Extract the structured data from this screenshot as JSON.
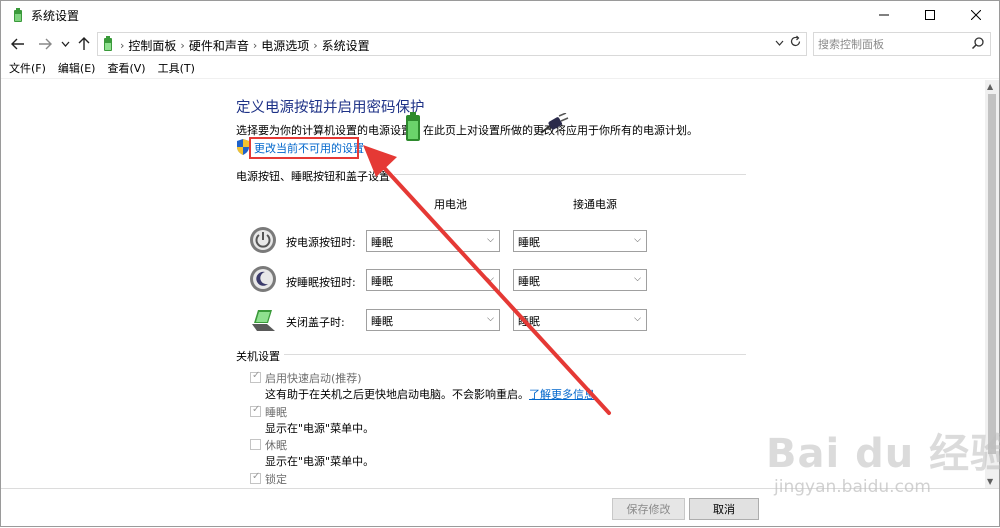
{
  "window": {
    "title": "系统设置"
  },
  "nav": {
    "breadcrumbs": [
      "控制面板",
      "硬件和声音",
      "电源选项",
      "系统设置"
    ],
    "search_placeholder": "搜索控制面板"
  },
  "menu": [
    "文件(F)",
    "编辑(E)",
    "查看(V)",
    "工具(T)"
  ],
  "main": {
    "heading": "定义电源按钮并启用密码保护",
    "description": "选择要为你的计算机设置的电源设置。在此页上对设置所做的更改将应用于你所有的电源计划。",
    "change_link": "更改当前不可用的设置",
    "power_section_title": "电源按钮、睡眠按钮和盖子设置",
    "col_battery": "用电池",
    "col_plugged": "接通电源",
    "rows": [
      {
        "label": "按电源按钮时:",
        "battery": "睡眠",
        "plugged": "睡眠"
      },
      {
        "label": "按睡眠按钮时:",
        "battery": "睡眠",
        "plugged": "睡眠"
      },
      {
        "label": "关闭盖子时:",
        "battery": "睡眠",
        "plugged": "睡眠"
      }
    ],
    "shutdown_section_title": "关机设置",
    "shutdown": [
      {
        "label": "启用快速启动(推荐)",
        "checked": true,
        "desc": "这有助于在关机之后更快地启动电脑。不会影响重启。",
        "link": "了解更多信息"
      },
      {
        "label": "睡眠",
        "checked": true,
        "desc": "显示在\"电源\"菜单中。"
      },
      {
        "label": "休眠",
        "checked": false,
        "desc": "显示在\"电源\"菜单中。"
      },
      {
        "label": "锁定",
        "checked": true
      }
    ]
  },
  "footer": {
    "save": "保存修改",
    "cancel": "取消"
  },
  "watermark": {
    "main": "Bai du 经验",
    "sub": "jingyan.baidu.com"
  },
  "colors": {
    "heading": "#1e3287",
    "link": "#0066cc",
    "highlight": "#e53935"
  }
}
